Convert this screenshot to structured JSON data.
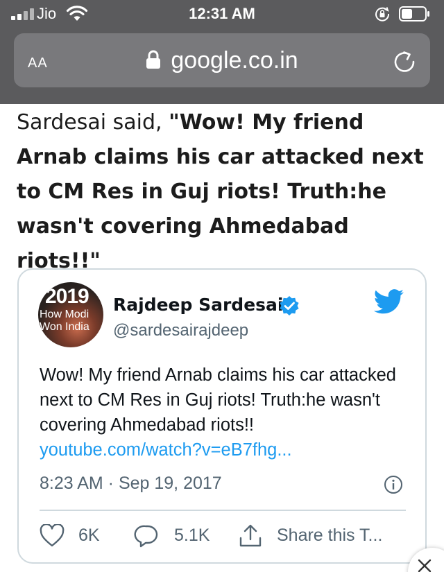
{
  "status_bar": {
    "carrier": "Jio",
    "time": "12:31 AM",
    "icons": [
      "signal-icon",
      "wifi-icon",
      "orientation-lock-icon",
      "battery-icon"
    ]
  },
  "browser": {
    "text_size_label": "AA",
    "url": "google.co.in",
    "icons": [
      "padlock-icon",
      "reload-icon"
    ]
  },
  "article": {
    "lead": "Sardesai said, ",
    "quote": "\"Wow! My friend Arnab claims his car attacked next to CM Res in Guj riots! Truth:he wasn't covering Ahmedabad riots!!\""
  },
  "tweet": {
    "avatar_text": {
      "year": "2019",
      "line1": "How Modi",
      "line2": "Won India"
    },
    "display_name": "Rajdeep Sardesai",
    "handle": "@sardesairajdeep",
    "text": "Wow! My friend Arnab claims his car attacked next to CM Res in Guj riots! Truth:he wasn't covering Ahmedabad riots!! ",
    "link": "youtube.com/watch?v=eB7fhg...",
    "timestamp": "8:23 AM · Sep 19, 2017",
    "likes": "6K",
    "replies": "5.1K",
    "share_label": "Share this T...",
    "colors": {
      "link": "#1d9bf0",
      "verified": "#1d9bf0",
      "twitter": "#1d9bf0",
      "muted": "#536471"
    }
  }
}
